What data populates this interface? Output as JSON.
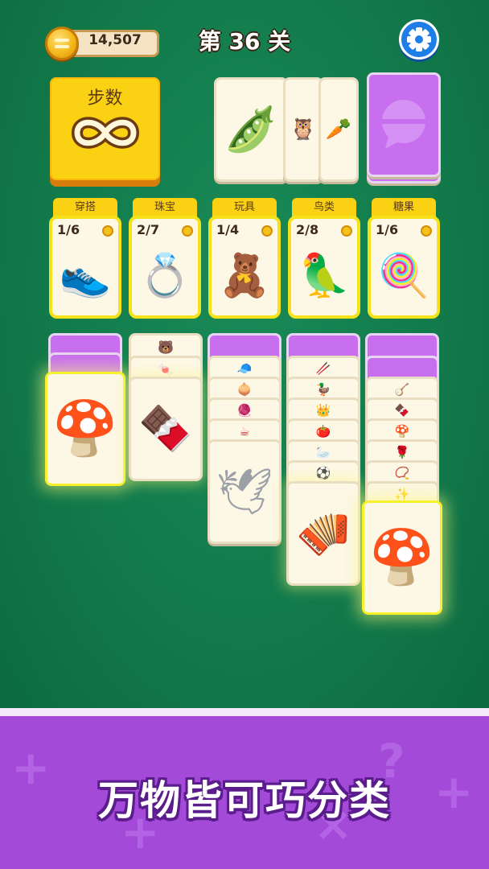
{
  "header": {
    "coins": "14,507",
    "level_title": "第 36 关",
    "coin_icon": "coin-icon",
    "settings_icon": "gear-icon"
  },
  "steps": {
    "label": "步数",
    "value_icon": "infinity-icon"
  },
  "draw_pile": {
    "revealed": [
      {
        "name": "pea-pod",
        "glyph": "🫛"
      },
      {
        "name": "owl",
        "glyph": "🦉"
      },
      {
        "name": "carrot",
        "glyph": "🥕"
      }
    ],
    "deck_icon": "chat-bubble-icon"
  },
  "categories": [
    {
      "label": "穿搭",
      "count": "1/6",
      "item": "sneaker",
      "glyph": "👟"
    },
    {
      "label": "珠宝",
      "count": "2/7",
      "item": "gold-ring",
      "glyph": "💍"
    },
    {
      "label": "玩具",
      "count": "1/4",
      "item": "doll",
      "glyph": "🧸"
    },
    {
      "label": "鸟类",
      "count": "2/8",
      "item": "parrot",
      "glyph": "🦜"
    },
    {
      "label": "糖果",
      "count": "1/6",
      "item": "lollipop",
      "glyph": "🍭"
    }
  ],
  "columns": [
    {
      "small": [],
      "top": {
        "name": "purple-mushroom",
        "glyph": "🍄"
      }
    },
    {
      "small": [
        {
          "name": "gummy-bear",
          "glyph": "🐻"
        },
        {
          "name": "wrapped-candy",
          "glyph": "🍬"
        }
      ],
      "top": {
        "name": "nougat",
        "glyph": "🍫"
      }
    },
    {
      "small": [
        {
          "name": "green-cap",
          "glyph": "🧢"
        },
        {
          "name": "onion",
          "glyph": "🧅"
        },
        {
          "name": "beanie",
          "glyph": "🧶"
        },
        {
          "name": "mug",
          "glyph": "☕"
        }
      ],
      "top": {
        "name": "dove",
        "glyph": "🕊"
      }
    },
    {
      "small": [
        {
          "name": "chopsticks",
          "glyph": "🥢"
        },
        {
          "name": "duck",
          "glyph": "🦆"
        },
        {
          "name": "tiara",
          "glyph": "👑"
        },
        {
          "name": "tomato",
          "glyph": "🍅"
        },
        {
          "name": "swan",
          "glyph": "🦢"
        },
        {
          "name": "ball",
          "glyph": "⚽"
        }
      ],
      "top": {
        "name": "accordion",
        "glyph": "🪗"
      }
    },
    {
      "small": [
        {
          "name": "harp",
          "glyph": "🪕"
        },
        {
          "name": "truffle",
          "glyph": "🍫"
        },
        {
          "name": "chanterelle",
          "glyph": "🍄"
        },
        {
          "name": "rose",
          "glyph": "🌹"
        },
        {
          "name": "pearl-necklace",
          "glyph": "📿"
        },
        {
          "name": "sparkler",
          "glyph": "✨"
        }
      ],
      "top": {
        "name": "red-mushroom",
        "glyph": "🍄"
      }
    }
  ],
  "banner": {
    "slogan": "万物皆可巧分类"
  },
  "colors": {
    "table_green": "#117a4c",
    "accent_yellow": "#fbd113",
    "card_purple": "#c86ff0",
    "banner_purple": "#a44ad9"
  }
}
